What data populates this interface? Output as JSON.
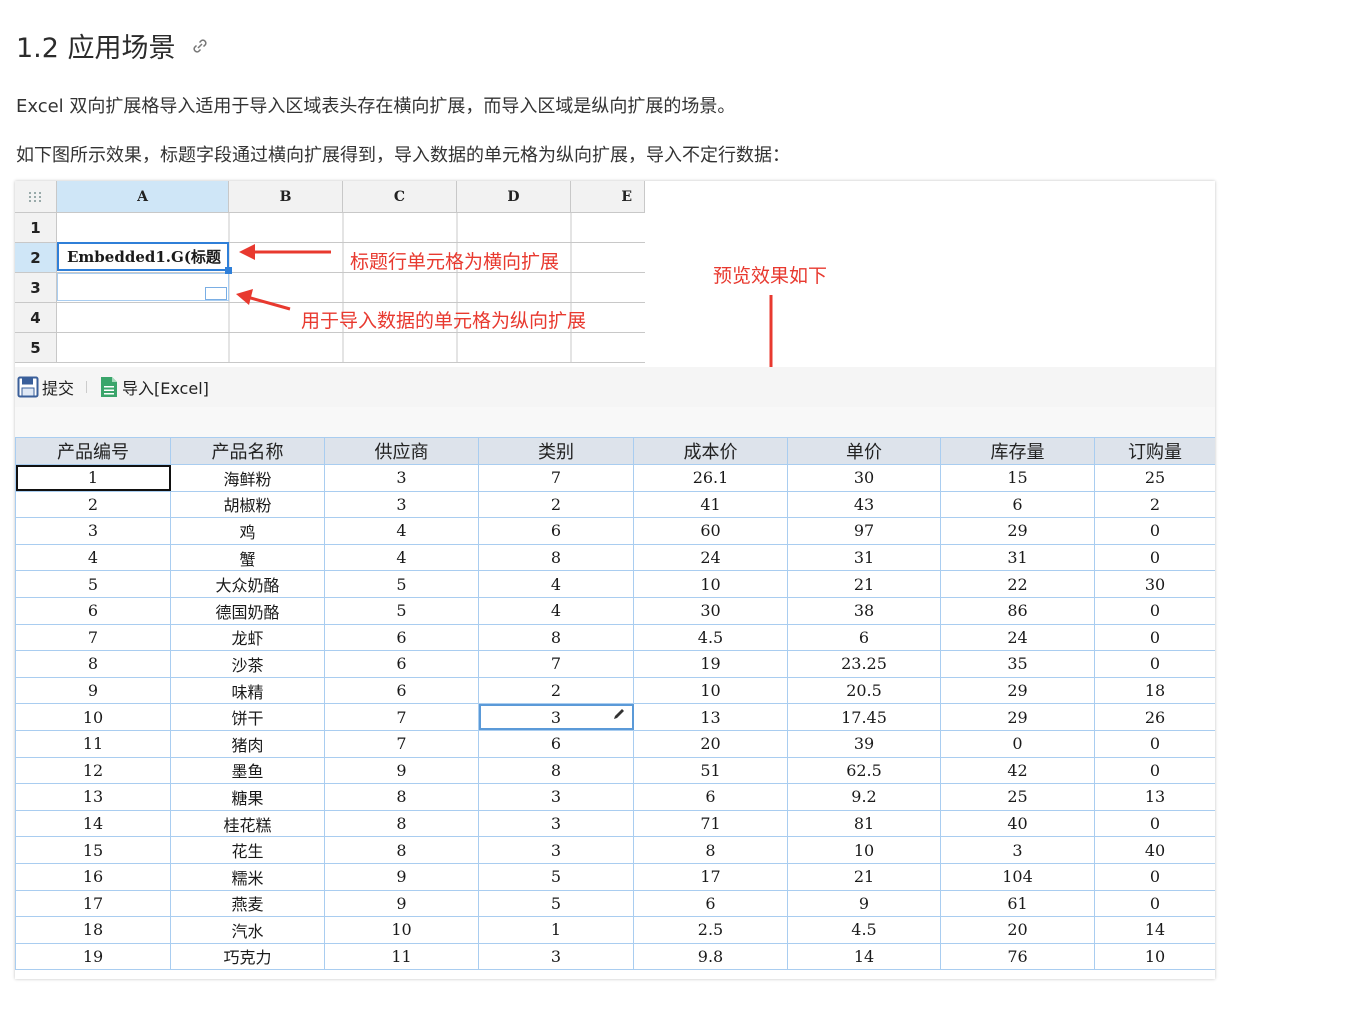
{
  "heading": {
    "title": "1.2 应用场景",
    "link_icon": "link-icon"
  },
  "paragraphs": [
    "Excel 双向扩展格导入适用于导入区域表头存在横向扩展，而导入区域是纵向扩展的场景。",
    "如下图所示效果，标题字段通过横向扩展得到，导入数据的单元格为纵向扩展，导入不定行数据："
  ],
  "designer": {
    "col_headers": [
      "A",
      "B",
      "C",
      "D",
      "E"
    ],
    "row_headers": [
      "1",
      "2",
      "3",
      "4",
      "5"
    ],
    "cell_a2": "Embedded1.G(标题"
  },
  "annotations": {
    "title_row": "标题行单元格为横向扩展",
    "data_cell": "用于导入数据的单元格为纵向扩展",
    "preview": "预览效果如下"
  },
  "colors": {
    "annotation": "#e8392f",
    "selection": "#2f7fd8",
    "grid_border": "#a9cdf0",
    "header_bg": "#dde3eb"
  },
  "toolbar": {
    "submit_label": "提交",
    "import_label": "导入[Excel]",
    "submit_icon": "save-icon",
    "import_icon": "excel-file-icon"
  },
  "table": {
    "headers": [
      "产品编号",
      "产品名称",
      "供应商",
      "类别",
      "成本价",
      "单价",
      "库存量",
      "订购量"
    ],
    "rows": [
      [
        "1",
        "海鲜粉",
        "3",
        "7",
        "26.1",
        "30",
        "15",
        "25"
      ],
      [
        "2",
        "胡椒粉",
        "3",
        "2",
        "41",
        "43",
        "6",
        "2"
      ],
      [
        "3",
        "鸡",
        "4",
        "6",
        "60",
        "97",
        "29",
        "0"
      ],
      [
        "4",
        "蟹",
        "4",
        "8",
        "24",
        "31",
        "31",
        "0"
      ],
      [
        "5",
        "大众奶酪",
        "5",
        "4",
        "10",
        "21",
        "22",
        "30"
      ],
      [
        "6",
        "德国奶酪",
        "5",
        "4",
        "30",
        "38",
        "86",
        "0"
      ],
      [
        "7",
        "龙虾",
        "6",
        "8",
        "4.5",
        "6",
        "24",
        "0"
      ],
      [
        "8",
        "沙茶",
        "6",
        "7",
        "19",
        "23.25",
        "35",
        "0"
      ],
      [
        "9",
        "味精",
        "6",
        "2",
        "10",
        "20.5",
        "29",
        "18"
      ],
      [
        "10",
        "饼干",
        "7",
        "3",
        "13",
        "17.45",
        "29",
        "26"
      ],
      [
        "11",
        "猪肉",
        "7",
        "6",
        "20",
        "39",
        "0",
        "0"
      ],
      [
        "12",
        "墨鱼",
        "9",
        "8",
        "51",
        "62.5",
        "42",
        "0"
      ],
      [
        "13",
        "糖果",
        "8",
        "3",
        "6",
        "9.2",
        "25",
        "13"
      ],
      [
        "14",
        "桂花糕",
        "8",
        "3",
        "71",
        "81",
        "40",
        "0"
      ],
      [
        "15",
        "花生",
        "8",
        "3",
        "8",
        "10",
        "3",
        "40"
      ],
      [
        "16",
        "糯米",
        "9",
        "5",
        "17",
        "21",
        "104",
        "0"
      ],
      [
        "17",
        "燕麦",
        "9",
        "5",
        "6",
        "9",
        "61",
        "0"
      ],
      [
        "18",
        "汽水",
        "10",
        "1",
        "2.5",
        "4.5",
        "20",
        "14"
      ],
      [
        "19",
        "巧克力",
        "11",
        "3",
        "9.8",
        "14",
        "76",
        "10"
      ]
    ]
  }
}
